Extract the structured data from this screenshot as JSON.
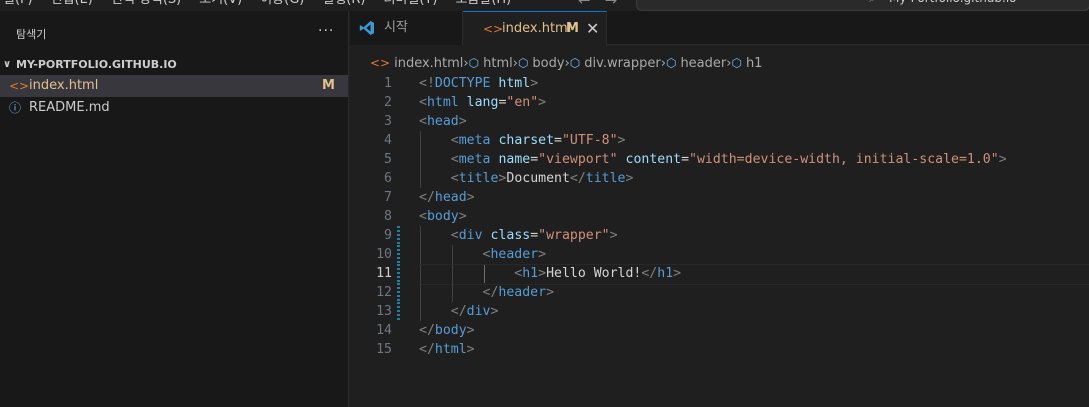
{
  "menu": [
    "일(F)",
    "편집(E)",
    "선택 영역(S)",
    "보기(V)",
    "이동(G)",
    "실행(R)",
    "터미널(T)",
    "도움말(H)"
  ],
  "nav": {
    "back": "←",
    "forward": "→"
  },
  "command_center": {
    "text": "My-Portfolio.github.io"
  },
  "sidebar": {
    "title": "탐색기",
    "more": "···",
    "folder": "MY-PORTFOLIO.GITHUB.IO",
    "files": [
      {
        "name": "index.html",
        "badge": "M",
        "icon": "html-file-icon",
        "color": "#e2c08d"
      },
      {
        "name": "README.md",
        "badge": "",
        "icon": "info-icon",
        "color": "#cccccc"
      }
    ]
  },
  "tabs": [
    {
      "label": "시작",
      "icon": "vscode-icon"
    },
    {
      "label": "index.html",
      "modified": "M",
      "icon": "html-file-icon"
    }
  ],
  "breadcrumb": [
    "index.html",
    "html",
    "body",
    "div.wrapper",
    "header",
    "h1"
  ],
  "code": {
    "line_numbers": [
      "1",
      "2",
      "3",
      "4",
      "5",
      "6",
      "7",
      "8",
      "9",
      "10",
      "11",
      "12",
      "13",
      "14",
      "15"
    ],
    "current_line": 11,
    "lines": [
      [
        {
          "t": "<!",
          "c": "br"
        },
        {
          "t": "DOCTYPE",
          "c": "tag"
        },
        {
          "t": " ",
          "c": "txt"
        },
        {
          "t": "html",
          "c": "attr"
        },
        {
          "t": ">",
          "c": "br"
        }
      ],
      [
        {
          "t": "<",
          "c": "br"
        },
        {
          "t": "html",
          "c": "tag"
        },
        {
          "t": " ",
          "c": "txt"
        },
        {
          "t": "lang",
          "c": "attr"
        },
        {
          "t": "=",
          "c": "txt"
        },
        {
          "t": "\"en\"",
          "c": "str"
        },
        {
          "t": ">",
          "c": "br"
        }
      ],
      [
        {
          "t": "<",
          "c": "br"
        },
        {
          "t": "head",
          "c": "tag"
        },
        {
          "t": ">",
          "c": "br"
        }
      ],
      [
        {
          "t": "    ",
          "c": "txt"
        },
        {
          "t": "<",
          "c": "br"
        },
        {
          "t": "meta",
          "c": "tag"
        },
        {
          "t": " ",
          "c": "txt"
        },
        {
          "t": "charset",
          "c": "attr"
        },
        {
          "t": "=",
          "c": "txt"
        },
        {
          "t": "\"UTF-8\"",
          "c": "str"
        },
        {
          "t": ">",
          "c": "br"
        }
      ],
      [
        {
          "t": "    ",
          "c": "txt"
        },
        {
          "t": "<",
          "c": "br"
        },
        {
          "t": "meta",
          "c": "tag"
        },
        {
          "t": " ",
          "c": "txt"
        },
        {
          "t": "name",
          "c": "attr"
        },
        {
          "t": "=",
          "c": "txt"
        },
        {
          "t": "\"viewport\"",
          "c": "str"
        },
        {
          "t": " ",
          "c": "txt"
        },
        {
          "t": "content",
          "c": "attr"
        },
        {
          "t": "=",
          "c": "txt"
        },
        {
          "t": "\"width=device-width, initial-scale=1.0\"",
          "c": "str"
        },
        {
          "t": ">",
          "c": "br"
        }
      ],
      [
        {
          "t": "    ",
          "c": "txt"
        },
        {
          "t": "<",
          "c": "br"
        },
        {
          "t": "title",
          "c": "tag"
        },
        {
          "t": ">",
          "c": "br"
        },
        {
          "t": "Document",
          "c": "txt"
        },
        {
          "t": "</",
          "c": "br"
        },
        {
          "t": "title",
          "c": "tag"
        },
        {
          "t": ">",
          "c": "br"
        }
      ],
      [
        {
          "t": "</",
          "c": "br"
        },
        {
          "t": "head",
          "c": "tag"
        },
        {
          "t": ">",
          "c": "br"
        }
      ],
      [
        {
          "t": "<",
          "c": "br"
        },
        {
          "t": "body",
          "c": "tag"
        },
        {
          "t": ">",
          "c": "br"
        }
      ],
      [
        {
          "t": "    ",
          "c": "txt"
        },
        {
          "t": "<",
          "c": "br"
        },
        {
          "t": "div",
          "c": "tag"
        },
        {
          "t": " ",
          "c": "txt"
        },
        {
          "t": "class",
          "c": "attr"
        },
        {
          "t": "=",
          "c": "txt"
        },
        {
          "t": "\"wrapper\"",
          "c": "str"
        },
        {
          "t": ">",
          "c": "br"
        }
      ],
      [
        {
          "t": "        ",
          "c": "txt"
        },
        {
          "t": "<",
          "c": "br"
        },
        {
          "t": "header",
          "c": "tag"
        },
        {
          "t": ">",
          "c": "br"
        }
      ],
      [
        {
          "t": "            ",
          "c": "txt"
        },
        {
          "t": "<",
          "c": "br"
        },
        {
          "t": "h1",
          "c": "tag"
        },
        {
          "t": ">",
          "c": "br"
        },
        {
          "t": "Hello World!",
          "c": "txt"
        },
        {
          "t": "</",
          "c": "br"
        },
        {
          "t": "h1",
          "c": "tag"
        },
        {
          "t": ">",
          "c": "br"
        }
      ],
      [
        {
          "t": "        ",
          "c": "txt"
        },
        {
          "t": "</",
          "c": "br"
        },
        {
          "t": "header",
          "c": "tag"
        },
        {
          "t": ">",
          "c": "br"
        }
      ],
      [
        {
          "t": "    ",
          "c": "txt"
        },
        {
          "t": "</",
          "c": "br"
        },
        {
          "t": "div",
          "c": "tag"
        },
        {
          "t": ">",
          "c": "br"
        }
      ],
      [
        {
          "t": "</",
          "c": "br"
        },
        {
          "t": "body",
          "c": "tag"
        },
        {
          "t": ">",
          "c": "br"
        }
      ],
      [
        {
          "t": "</",
          "c": "br"
        },
        {
          "t": "html",
          "c": "tag"
        },
        {
          "t": ">",
          "c": "br"
        }
      ]
    ],
    "modified_lines": [
      9,
      10,
      11,
      12,
      13
    ]
  },
  "colors": {
    "accent": "#0078d4",
    "modified": "#e2c08d",
    "html_icon": "#e37933",
    "editor_bg": "#1f1f1f",
    "sidebar_bg": "#181818"
  }
}
